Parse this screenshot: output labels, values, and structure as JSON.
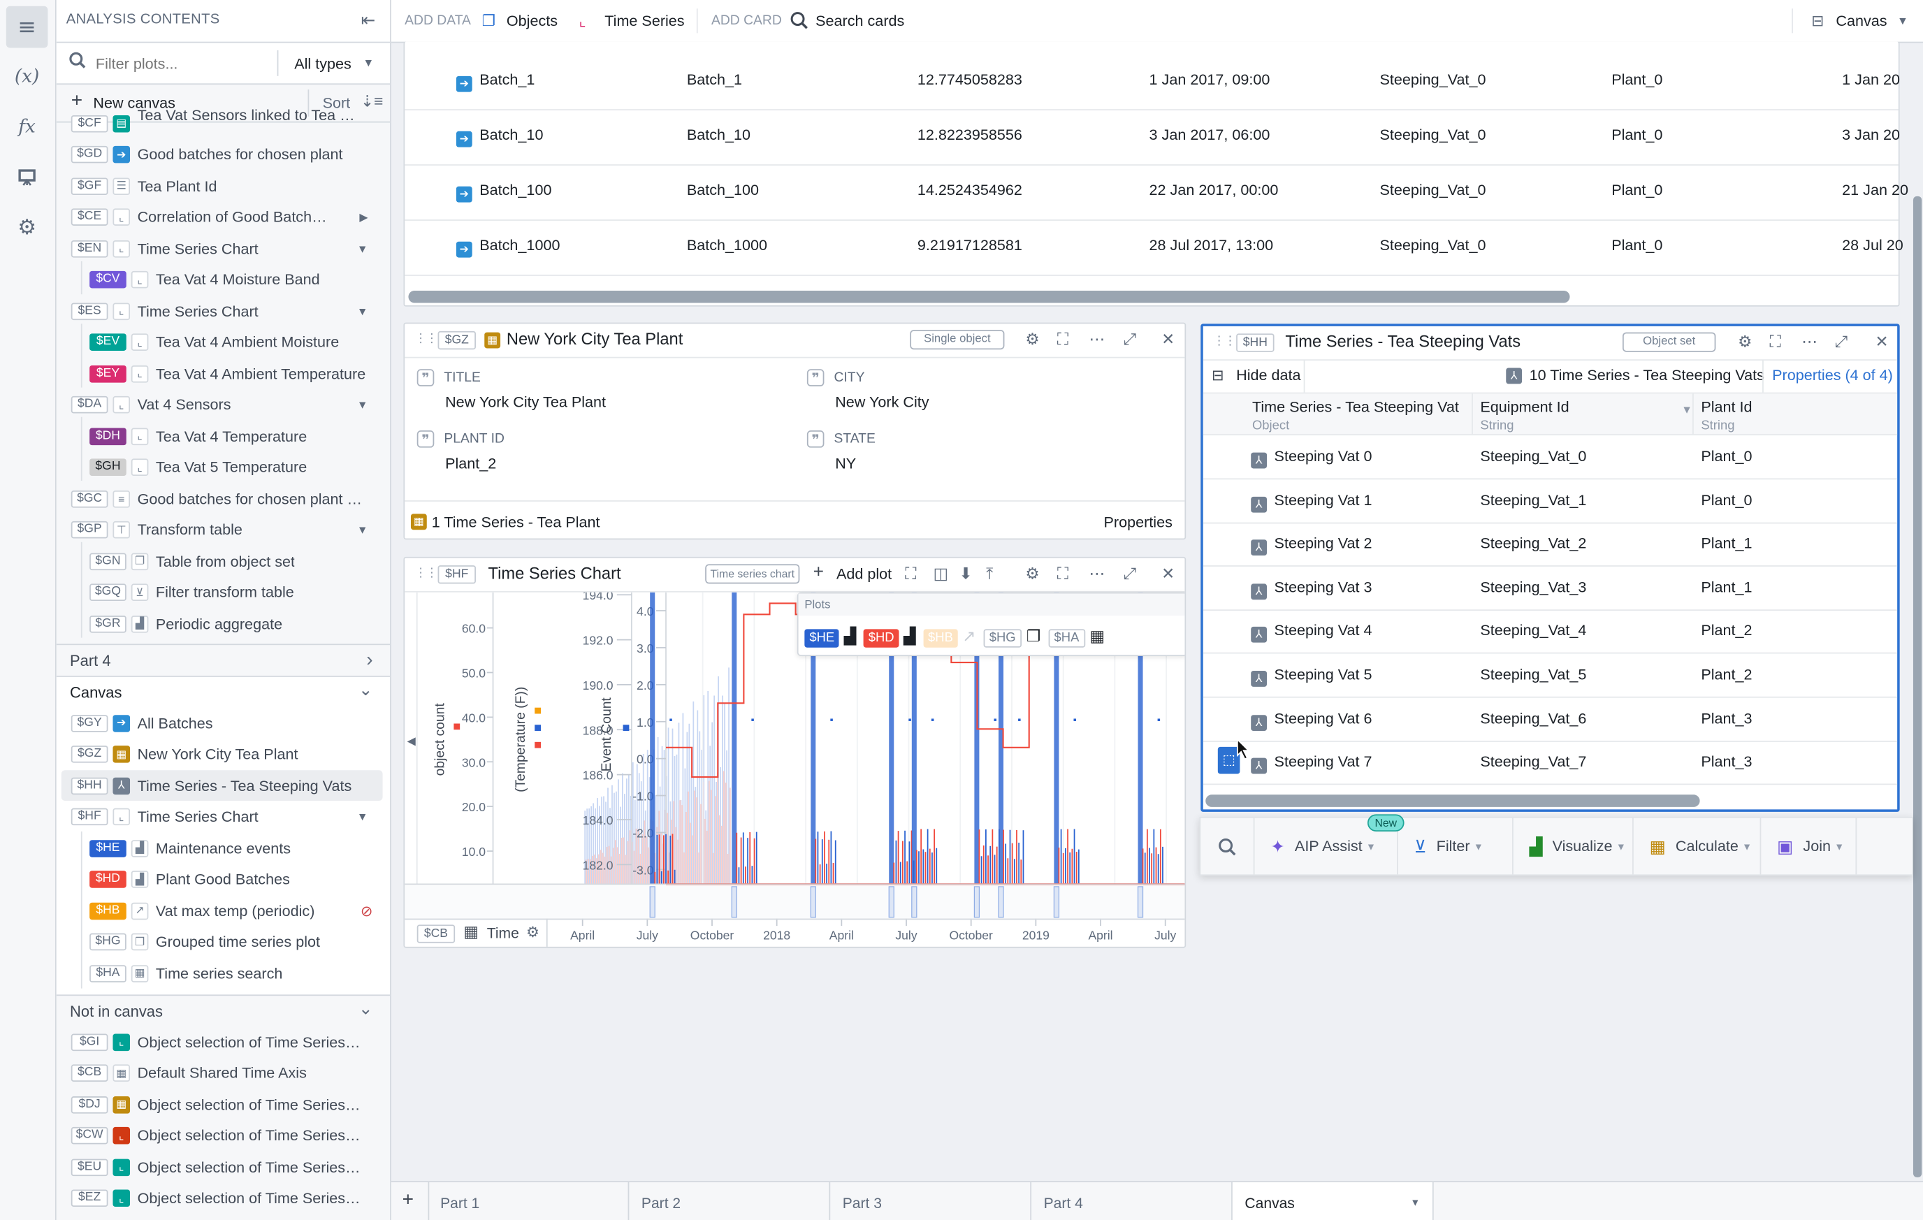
{
  "rail": {
    "items": [
      {
        "name": "contents-icon",
        "glyph": "≡"
      },
      {
        "name": "variables-icon",
        "glyph": "(x)"
      },
      {
        "name": "functions-icon",
        "glyph": "fx"
      },
      {
        "name": "presentation-icon",
        "glyph": "⛶"
      },
      {
        "name": "settings-icon",
        "glyph": "⚙"
      }
    ]
  },
  "sidebar": {
    "title": "ANALYSIS CONTENTS",
    "filter_placeholder": "Filter plots...",
    "type_select": "All types",
    "new_canvas": "New canvas",
    "sort": "Sort",
    "items": [
      {
        "tag": "$CF",
        "label": "Tea Vat Sensors linked to Tea St...",
        "icon": "▤",
        "icon_color": "#00a396",
        "level": 0,
        "partial": true
      },
      {
        "tag": "$GD",
        "label": "Good batches for chosen plant",
        "icon": "➔",
        "icon_color": "#2d8fd5",
        "level": 0
      },
      {
        "tag": "$GF",
        "label": "Tea Plant Id",
        "icon": "☰",
        "level": 0
      },
      {
        "tag": "$CE",
        "label": "Correlation of Good Batches…",
        "icon": "⌞",
        "level": 0,
        "caret": "▶"
      },
      {
        "tag": "$EN",
        "label": "Time Series Chart",
        "icon": "⌞",
        "level": 0,
        "caret": "▼"
      },
      {
        "tag": "$CV",
        "label": "Tea Vat 4 Moisture Band",
        "icon": "⌞",
        "level": 1,
        "tag_color": "#7157d9"
      },
      {
        "tag": "$ES",
        "label": "Time Series Chart",
        "icon": "⌞",
        "level": 0,
        "caret": "▼"
      },
      {
        "tag": "$EV",
        "label": "Tea Vat 4 Ambient Moisture",
        "icon": "⌞",
        "level": 1,
        "tag_color": "#00a396"
      },
      {
        "tag": "$EY",
        "label": "Tea Vat 4 Ambient Temperature",
        "icon": "⌞",
        "level": 1,
        "tag_color": "#db2c6f"
      },
      {
        "tag": "$DA",
        "label": "Vat 4 Sensors",
        "icon": "⌞",
        "level": 0,
        "caret": "▼"
      },
      {
        "tag": "$DH",
        "label": "Tea Vat 4 Temperature",
        "icon": "⌞",
        "level": 1,
        "tag_color": "#8a3b8f"
      },
      {
        "tag": "$GH",
        "label": "Tea Vat 5 Temperature",
        "icon": "⌞",
        "level": 1,
        "tag_color": "#cfcfcf",
        "tag_text": "#1c2127"
      },
      {
        "tag": "$GC",
        "label": "Good batches for chosen plant …",
        "icon": "≡",
        "level": 0
      },
      {
        "tag": "$GP",
        "label": "Transform table",
        "icon": "⊤",
        "level": 0,
        "caret": "▼"
      },
      {
        "tag": "$GN",
        "label": "Table from object set",
        "icon": "❐",
        "level": 1
      },
      {
        "tag": "$GQ",
        "label": "Filter transform table",
        "icon": "⊻",
        "level": 1
      },
      {
        "tag": "$GR",
        "label": "Periodic aggregate",
        "icon": "▟",
        "level": 1
      }
    ],
    "part4": "Part 4",
    "canvas_section": "Canvas",
    "canvas_items": [
      {
        "tag": "$GY",
        "label": "All Batches",
        "icon": "➔",
        "icon_color": "#2d8fd5",
        "level": 0
      },
      {
        "tag": "$GZ",
        "label": "New York City Tea Plant",
        "icon": "▦",
        "icon_color": "#c08b0f",
        "level": 0
      },
      {
        "tag": "$HH",
        "label": "Time Series - Tea Steeping Vats",
        "icon": "⅄",
        "icon_color": "#738091",
        "level": 0,
        "selected": true
      },
      {
        "tag": "$HF",
        "label": "Time Series Chart",
        "icon": "⌞",
        "level": 0,
        "caret": "▼"
      },
      {
        "tag": "$HE",
        "label": "Maintenance events",
        "icon": "▟",
        "level": 1,
        "tag_color": "#2962d1"
      },
      {
        "tag": "$HD",
        "label": "Plant Good Batches",
        "icon": "▟",
        "level": 1,
        "tag_color": "#f0483b"
      },
      {
        "tag": "$HB",
        "label": "Vat max temp (periodic)",
        "icon": "↗",
        "level": 1,
        "tag_color": "#f59f0a",
        "hidden": true
      },
      {
        "tag": "$HG",
        "label": "Grouped time series plot",
        "icon": "❐",
        "level": 1
      },
      {
        "tag": "$HA",
        "label": "Time series search",
        "icon": "▦",
        "level": 1
      }
    ],
    "not_in_canvas_section": "Not in canvas",
    "not_in_canvas_items": [
      {
        "tag": "$GI",
        "label": "Object selection of Time Series -…",
        "icon": "⌞",
        "icon_color": "#00a396"
      },
      {
        "tag": "$CB",
        "label": "Default Shared Time Axis",
        "icon": "▦"
      },
      {
        "tag": "$DJ",
        "label": "Object selection of Time Series -…",
        "icon": "▦",
        "icon_color": "#c08b0f"
      },
      {
        "tag": "$CW",
        "label": "Object selection of Time Series -…",
        "icon": "⌞",
        "icon_color": "#d13913"
      },
      {
        "tag": "$EU",
        "label": "Object selection of Time Series -…",
        "icon": "⌞",
        "icon_color": "#00a396"
      },
      {
        "tag": "$EZ",
        "label": "Object selection of Time Series -…",
        "icon": "⌞",
        "icon_color": "#00a396"
      }
    ]
  },
  "topbar": {
    "add_data": "ADD DATA",
    "objects": "Objects",
    "time_series": "Time Series",
    "add_card": "ADD CARD",
    "search_cards": "Search cards",
    "view_mode": "Canvas"
  },
  "batches_table": {
    "rows": [
      [
        "Batch_1",
        "Batch_1",
        "12.7745058283",
        "1 Jan 2017, 09:00",
        "Steeping_Vat_0",
        "Plant_0",
        "1 Jan 20"
      ],
      [
        "Batch_10",
        "Batch_10",
        "12.8223958556",
        "3 Jan 2017, 06:00",
        "Steeping_Vat_0",
        "Plant_0",
        "3 Jan 20"
      ],
      [
        "Batch_100",
        "Batch_100",
        "14.2524354962",
        "22 Jan 2017, 00:00",
        "Steeping_Vat_0",
        "Plant_0",
        "21 Jan 20"
      ],
      [
        "Batch_1000",
        "Batch_1000",
        "9.21917128581",
        "28 Jul 2017, 13:00",
        "Steeping_Vat_0",
        "Plant_0",
        "28 Jul 20"
      ]
    ]
  },
  "plant_card": {
    "tag": "$GZ",
    "title": "New York City Tea Plant",
    "mode": "Single object",
    "props": [
      {
        "label": "TITLE",
        "value": "New York City Tea Plant"
      },
      {
        "label": "CITY",
        "value": "New York City"
      },
      {
        "label": "PLANT ID",
        "value": "Plant_2"
      },
      {
        "label": "STATE",
        "value": "NY"
      }
    ],
    "footer": "1 Time Series - Tea Plant",
    "properties": "Properties"
  },
  "chart_card": {
    "tag": "$HF",
    "title": "Time Series Chart",
    "mode": "Time series chart",
    "add_plot": "Add plot",
    "plots_label": "Plots",
    "plot_tags": [
      {
        "tag": "$HE",
        "color": "#2962d1"
      },
      {
        "tag": "$HD",
        "color": "#f0483b"
      },
      {
        "tag": "$HB",
        "color": "#fde4c3",
        "faded": true
      },
      {
        "tag": "$HG",
        "color": "#ffffff"
      },
      {
        "tag": "$HA",
        "color": "#ffffff"
      }
    ],
    "axis_tag": "$CB",
    "axis_label": "Time"
  },
  "chart_data": {
    "type": "line",
    "title": "Time Series Chart",
    "xlabel": "Time",
    "x_ticks": [
      "April",
      "July",
      "October",
      "2018",
      "April",
      "July",
      "October",
      "2019",
      "April",
      "July"
    ],
    "y_axes": [
      {
        "label": "object count",
        "ticks": [
          10.0,
          20.0,
          30.0,
          40.0,
          50.0,
          60.0
        ],
        "legend_colors": [
          "#f0483b"
        ]
      },
      {
        "label": "(Temperature (F))",
        "ticks": [
          182.0,
          184.0,
          186.0,
          188.0,
          190.0,
          192.0,
          194.0
        ],
        "legend_colors": [
          "#f59f0a",
          "#2962d1",
          "#f0483b"
        ]
      },
      {
        "label": "Event Count",
        "ticks": [
          -3.0,
          -2.0,
          -1.0,
          0.0,
          1.0,
          2.0,
          3.0,
          4.0
        ],
        "legend_colors": [
          "#2962d1"
        ]
      }
    ],
    "series": [
      {
        "name": "Maintenance events",
        "color": "#2962d1",
        "event_positions": [
          0.0,
          0.115,
          0.226,
          0.336,
          0.368,
          0.456,
          0.49,
          0.568,
          0.686
        ]
      },
      {
        "name": "Plant Good Batches",
        "color": "#f0483b",
        "step_values": [
          0.3,
          -0.5,
          1.5,
          3.9,
          4.2,
          3.9,
          4.2,
          3.9,
          4.2,
          3.8,
          3.4,
          2.6,
          0.8,
          0.3,
          3.2,
          4.4,
          4.0,
          3.6,
          4.3,
          4.1
        ]
      }
    ]
  },
  "vats_card": {
    "tag": "$HH",
    "title": "Time Series - Tea Steeping Vats",
    "mode": "Object set",
    "hide_data": "Hide data",
    "count_label": "10 Time Series - Tea Steeping Vats",
    "properties": "Properties (4 of 4)",
    "columns": [
      {
        "name": "Time Series - Tea Steeping Vat",
        "type": "Object"
      },
      {
        "name": "Equipment Id",
        "type": "String"
      },
      {
        "name": "Plant Id",
        "type": "String"
      }
    ],
    "rows": [
      [
        "Steeping Vat 0",
        "Steeping_Vat_0",
        "Plant_0"
      ],
      [
        "Steeping Vat 1",
        "Steeping_Vat_1",
        "Plant_0"
      ],
      [
        "Steeping Vat 2",
        "Steeping_Vat_2",
        "Plant_1"
      ],
      [
        "Steeping Vat 3",
        "Steeping_Vat_3",
        "Plant_1"
      ],
      [
        "Steeping Vat 4",
        "Steeping_Vat_4",
        "Plant_2"
      ],
      [
        "Steeping Vat 5",
        "Steeping_Vat_5",
        "Plant_2"
      ],
      [
        "Steeping Vat 6",
        "Steeping_Vat_6",
        "Plant_3"
      ],
      [
        "Steeping Vat 7",
        "Steeping_Vat_7",
        "Plant_3"
      ]
    ]
  },
  "toolbar": {
    "new_badge": "New",
    "items": [
      {
        "label": "AIP Assist",
        "glyph": "✦",
        "color": "#7157d9"
      },
      {
        "label": "Filter",
        "glyph": "⊻",
        "color": "#2d72d2"
      },
      {
        "label": "Visualize",
        "glyph": "▟",
        "color": "#238c2c"
      },
      {
        "label": "Calculate",
        "glyph": "▦",
        "color": "#c08b0f"
      },
      {
        "label": "Join",
        "glyph": "▣",
        "color": "#7157d9"
      }
    ]
  },
  "bottom_tabs": {
    "items": [
      "Part 1",
      "Part 2",
      "Part 3",
      "Part 4",
      "Canvas"
    ],
    "active": "Canvas"
  }
}
